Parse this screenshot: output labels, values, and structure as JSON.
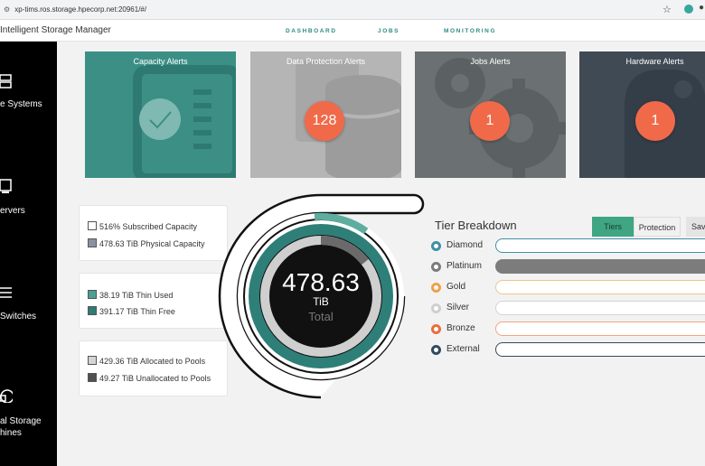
{
  "browser": {
    "url": "xp-tims.ros.storage.hpecorp.net:20961/#/"
  },
  "app": {
    "title": "Intelligent Storage Manager"
  },
  "nav": [
    "DASHBOARD",
    "JOBS",
    "MONITORING"
  ],
  "sidebar": [
    {
      "label": "e Systems",
      "icon": "storage-icon"
    },
    {
      "label": "ervers",
      "icon": "server-icon"
    },
    {
      "label": "Switches",
      "icon": "switch-icon"
    },
    {
      "label": "al Storage\nhines",
      "icon": "virtual-storage-icon"
    }
  ],
  "tiles": [
    {
      "title": "Capacity Alerts",
      "count": "",
      "color": "#3b8f85",
      "icon": "checkmark-icon"
    },
    {
      "title": "Data Protection Alerts",
      "count": "128",
      "color": "#b5b5b5",
      "icon": "database-icon"
    },
    {
      "title": "Jobs Alerts",
      "count": "1",
      "color": "#6b7173",
      "icon": "gears-icon"
    },
    {
      "title": "Hardware Alerts",
      "count": "1",
      "color": "#3f4a55",
      "icon": "hardware-icon"
    }
  ],
  "capacity": {
    "subscribed": "516% Subscribed Capacity",
    "physical": "478.63 TiB Physical Capacity",
    "thin_used": "38.19 TiB Thin Used",
    "thin_free": "391.17 TiB Thin Free",
    "allocated": "429.36 TiB Allocated to Pools",
    "unallocated": "49.27 TiB Unallocated to Pools"
  },
  "donut": {
    "value": "478.63",
    "unit": "TiB",
    "label": "Total"
  },
  "tier_breakdown": {
    "title": "Tier Breakdown",
    "tabs": [
      "Tiers",
      "Protection",
      "Sav"
    ],
    "tiers": [
      {
        "name": "Diamond",
        "color": "#3e90a8"
      },
      {
        "name": "Platinum",
        "color": "#7c7c7c"
      },
      {
        "name": "Gold",
        "color": "#f0a04a"
      },
      {
        "name": "Silver",
        "color": "#cfcfcf"
      },
      {
        "name": "Bronze",
        "color": "#e8703a"
      },
      {
        "name": "External",
        "color": "#2f4a62"
      }
    ]
  }
}
